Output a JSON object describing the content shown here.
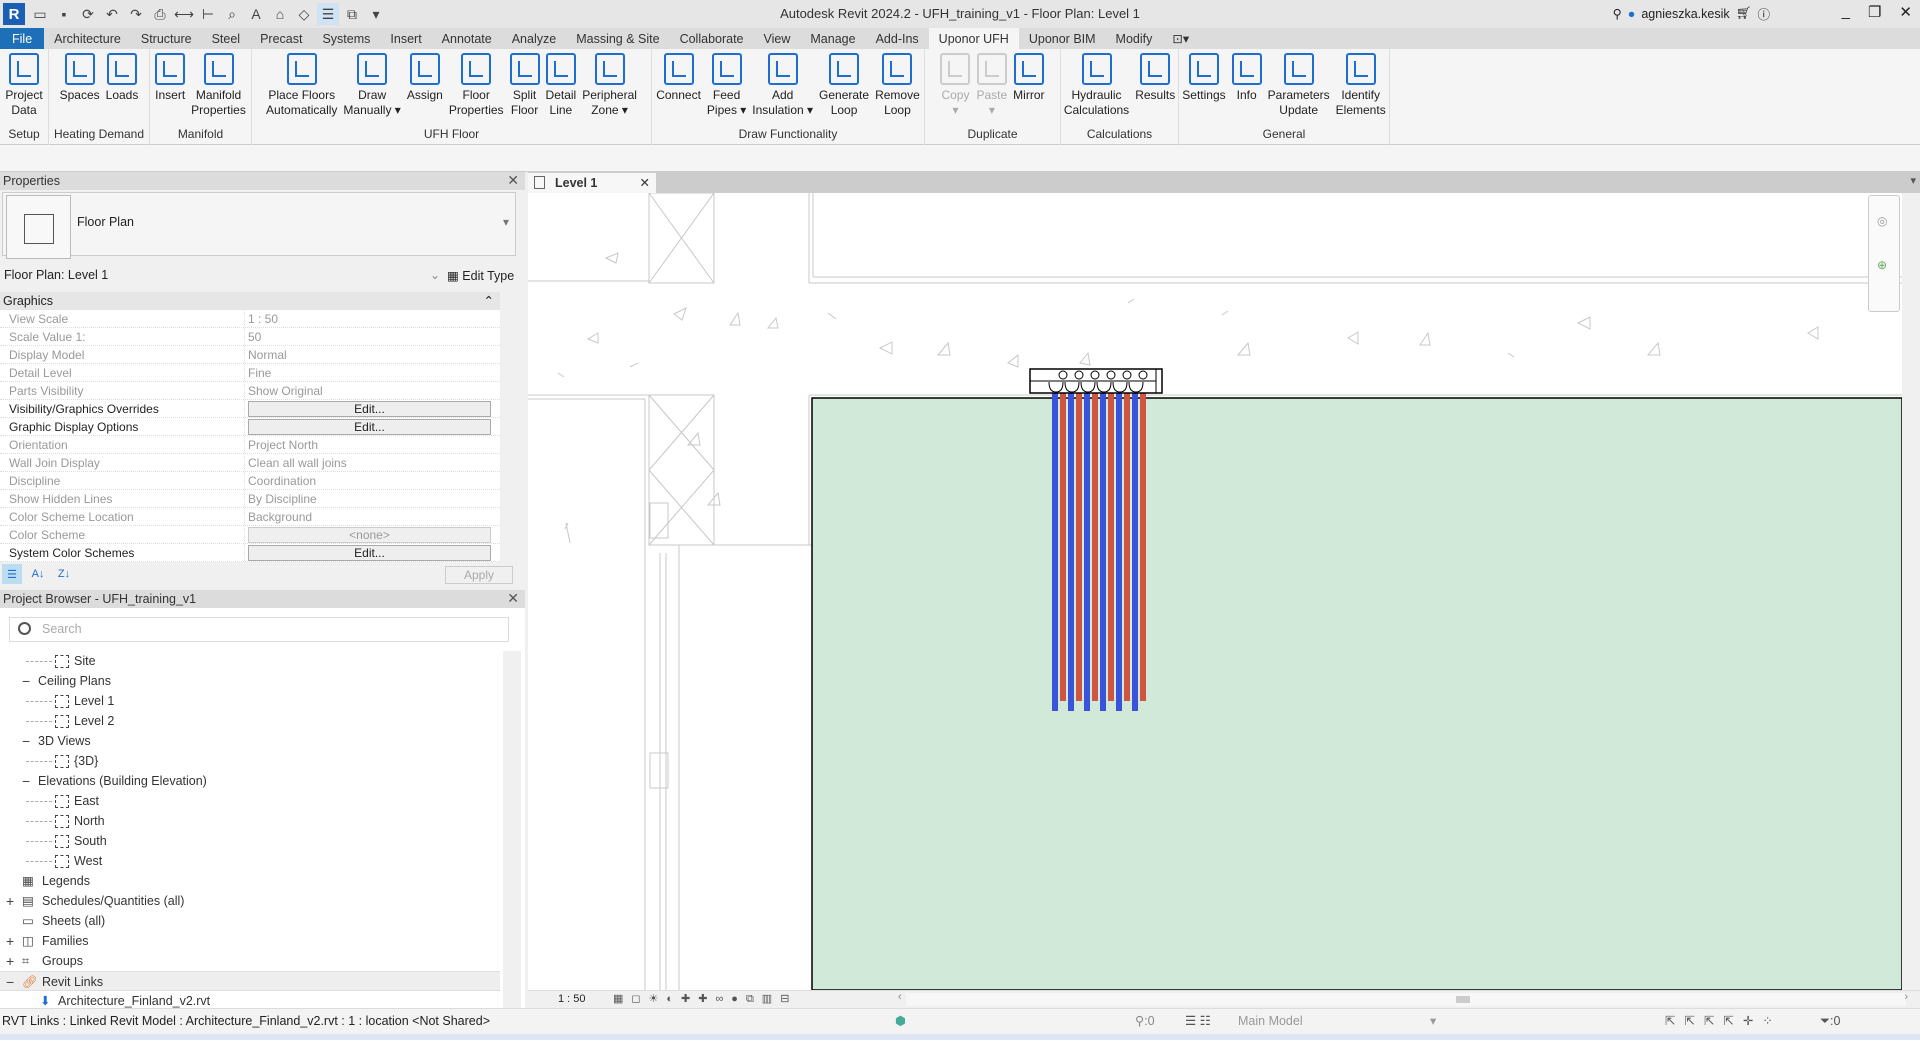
{
  "app": {
    "title": "Autodesk Revit 2024.2 - UFH_training_v1 - Floor Plan: Level 1",
    "user": "agnieszka.kesik",
    "logo": "R"
  },
  "tabs": [
    "File",
    "Architecture",
    "Structure",
    "Steel",
    "Precast",
    "Systems",
    "Insert",
    "Annotate",
    "Analyze",
    "Massing & Site",
    "Collaborate",
    "View",
    "Manage",
    "Add-Ins",
    "Uponor UFH",
    "Uponor BIM",
    "Modify"
  ],
  "active_tab": "Uponor UFH",
  "ribbon": [
    {
      "label": "Setup",
      "w": 49,
      "buttons": [
        {
          "label": "Project\nData"
        }
      ]
    },
    {
      "label": "Heating Demand",
      "w": 101,
      "buttons": [
        {
          "label": "Spaces"
        },
        {
          "label": "Loads"
        }
      ]
    },
    {
      "label": "Manifold",
      "w": 102,
      "buttons": [
        {
          "label": "Insert"
        },
        {
          "label": "Manifold\nProperties"
        }
      ]
    },
    {
      "label": "UFH Floor",
      "w": 400,
      "buttons": [
        {
          "label": "Place Floors\nAutomatically"
        },
        {
          "label": "Draw\nManually ▾"
        },
        {
          "label": "Assign"
        },
        {
          "label": "Floor\nProperties"
        },
        {
          "label": "Split\nFloor"
        },
        {
          "label": "Detail\nLine"
        },
        {
          "label": "Peripheral\nZone ▾"
        }
      ]
    },
    {
      "label": "Draw Functionality",
      "w": 273,
      "buttons": [
        {
          "label": "Connect"
        },
        {
          "label": "Feed\nPipes ▾"
        },
        {
          "label": "Add\nInsulation ▾"
        },
        {
          "label": "Generate\nLoop"
        },
        {
          "label": "Remove\nLoop"
        }
      ]
    },
    {
      "label": "Duplicate",
      "w": 136,
      "buttons": [
        {
          "label": "Copy\n▾",
          "disabled": true
        },
        {
          "label": "Paste\n▾",
          "disabled": true
        },
        {
          "label": "Mirror"
        }
      ]
    },
    {
      "label": "Calculations",
      "w": 118,
      "buttons": [
        {
          "label": "Hydraulic\nCalculations"
        },
        {
          "label": "Results"
        }
      ]
    },
    {
      "label": "General",
      "w": 211,
      "buttons": [
        {
          "label": "Settings"
        },
        {
          "label": "Info"
        },
        {
          "label": "Parameters\nUpdate"
        },
        {
          "label": "Identify\nElements"
        }
      ]
    }
  ],
  "properties": {
    "title": "Properties",
    "type_name": "Floor Plan",
    "instance": "Floor Plan: Level 1",
    "edit_type": "Edit Type",
    "section": "Graphics",
    "apply": "Apply",
    "rows": [
      {
        "name": "View Scale",
        "value": "1 : 50"
      },
      {
        "name": "Scale Value    1:",
        "value": "50"
      },
      {
        "name": "Display Model",
        "value": "Normal"
      },
      {
        "name": "Detail Level",
        "value": "Fine"
      },
      {
        "name": "Parts Visibility",
        "value": "Show Original"
      },
      {
        "name": "Visibility/Graphics Overrides",
        "value": "Edit...",
        "button": true,
        "enabled": true
      },
      {
        "name": "Graphic Display Options",
        "value": "Edit...",
        "button": true,
        "enabled": true
      },
      {
        "name": "Orientation",
        "value": "Project North"
      },
      {
        "name": "Wall Join Display",
        "value": "Clean all wall joins"
      },
      {
        "name": "Discipline",
        "value": "Coordination"
      },
      {
        "name": "Show Hidden Lines",
        "value": "By Discipline"
      },
      {
        "name": "Color Scheme Location",
        "value": "Background"
      },
      {
        "name": "Color Scheme",
        "value": "<none>",
        "button": true,
        "dim": true
      },
      {
        "name": "System Color Schemes",
        "value": "Edit...",
        "button": true,
        "enabled": true
      }
    ]
  },
  "browser": {
    "title": "Project Browser - UFH_training_v1",
    "search_placeholder": "Search",
    "items": [
      {
        "label": "Site",
        "level": 2,
        "icon": "view"
      },
      {
        "label": "Ceiling Plans",
        "level": 1,
        "toggle": "−"
      },
      {
        "label": "Level 1",
        "level": 2,
        "icon": "view"
      },
      {
        "label": "Level 2",
        "level": 2,
        "icon": "view"
      },
      {
        "label": "3D Views",
        "level": 1,
        "toggle": "−"
      },
      {
        "label": "{3D}",
        "level": 2,
        "icon": "view"
      },
      {
        "label": "Elevations (Building Elevation)",
        "level": 1,
        "toggle": "−"
      },
      {
        "label": "East",
        "level": 2,
        "icon": "view"
      },
      {
        "label": "North",
        "level": 2,
        "icon": "view"
      },
      {
        "label": "South",
        "level": 2,
        "icon": "view"
      },
      {
        "label": "West",
        "level": 2,
        "icon": "view"
      },
      {
        "label": "Legends",
        "level": 0,
        "icon": "legend"
      },
      {
        "label": "Schedules/Quantities (all)",
        "level": 0,
        "icon": "schedule",
        "toggle": "+"
      },
      {
        "label": "Sheets (all)",
        "level": 0,
        "icon": "sheet"
      },
      {
        "label": "Families",
        "level": 0,
        "icon": "family",
        "toggle": "+"
      },
      {
        "label": "Groups",
        "level": 0,
        "icon": "group",
        "toggle": "+"
      },
      {
        "label": "Revit Links",
        "level": 0,
        "icon": "link",
        "toggle": "−",
        "selected": true
      },
      {
        "label": "Architecture_Finland_v2.rvt",
        "level": 1,
        "icon": "link-arrow"
      }
    ]
  },
  "view": {
    "tab": "Level 1",
    "scale": "1 : 50",
    "loops": 6,
    "supply_color": "#3a53d8",
    "return_color": "#d05540",
    "floor_color": "#d0e9d9"
  },
  "status": {
    "text": "RVT Links : Linked Revit Model : Architecture_Finland_v2.rvt : 1 : location <Not Shared>",
    "count1": ":0",
    "model": "Main Model",
    "filter": ":0"
  }
}
